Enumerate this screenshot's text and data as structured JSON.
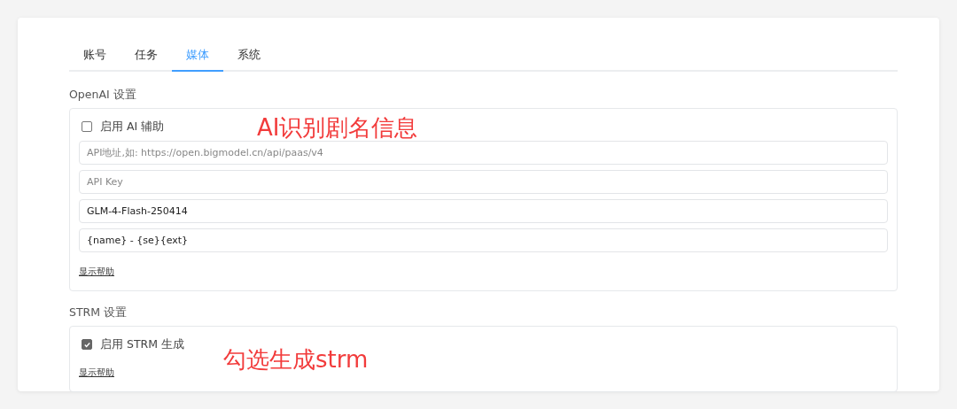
{
  "tabs": [
    {
      "label": "账号",
      "selected": false
    },
    {
      "label": "任务",
      "selected": false
    },
    {
      "label": "媒体",
      "selected": true
    },
    {
      "label": "系统",
      "selected": false
    }
  ],
  "sections": [
    {
      "title": "OpenAI 设置",
      "checkbox": {
        "label": "启用 AI 辅助",
        "checked": false
      },
      "fields": [
        {
          "placeholder": "API地址,如: https://open.bigmodel.cn/api/paas/v4"
        },
        {
          "placeholder": "API Key"
        },
        {
          "value": "GLM-4-Flash-250414"
        },
        {
          "value": "{name} - {se}{ext}"
        }
      ],
      "help_link": "显示帮助",
      "annotation": "AI识别剧名信息"
    },
    {
      "title": "STRM 设置",
      "checkbox": {
        "label": "启用 STRM 生成",
        "checked": true
      },
      "help_link": "显示帮助",
      "annotation": "勾选生成strm"
    }
  ]
}
